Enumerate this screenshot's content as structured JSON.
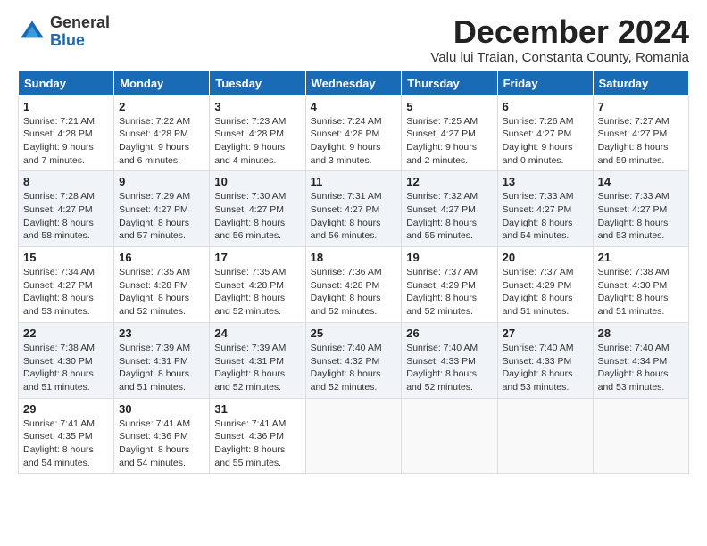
{
  "header": {
    "logo_general": "General",
    "logo_blue": "Blue",
    "month_title": "December 2024",
    "location": "Valu lui Traian, Constanta County, Romania"
  },
  "weekdays": [
    "Sunday",
    "Monday",
    "Tuesday",
    "Wednesday",
    "Thursday",
    "Friday",
    "Saturday"
  ],
  "weeks": [
    [
      {
        "day": "1",
        "info": "Sunrise: 7:21 AM\nSunset: 4:28 PM\nDaylight: 9 hours\nand 7 minutes."
      },
      {
        "day": "2",
        "info": "Sunrise: 7:22 AM\nSunset: 4:28 PM\nDaylight: 9 hours\nand 6 minutes."
      },
      {
        "day": "3",
        "info": "Sunrise: 7:23 AM\nSunset: 4:28 PM\nDaylight: 9 hours\nand 4 minutes."
      },
      {
        "day": "4",
        "info": "Sunrise: 7:24 AM\nSunset: 4:28 PM\nDaylight: 9 hours\nand 3 minutes."
      },
      {
        "day": "5",
        "info": "Sunrise: 7:25 AM\nSunset: 4:27 PM\nDaylight: 9 hours\nand 2 minutes."
      },
      {
        "day": "6",
        "info": "Sunrise: 7:26 AM\nSunset: 4:27 PM\nDaylight: 9 hours\nand 0 minutes."
      },
      {
        "day": "7",
        "info": "Sunrise: 7:27 AM\nSunset: 4:27 PM\nDaylight: 8 hours\nand 59 minutes."
      }
    ],
    [
      {
        "day": "8",
        "info": "Sunrise: 7:28 AM\nSunset: 4:27 PM\nDaylight: 8 hours\nand 58 minutes."
      },
      {
        "day": "9",
        "info": "Sunrise: 7:29 AM\nSunset: 4:27 PM\nDaylight: 8 hours\nand 57 minutes."
      },
      {
        "day": "10",
        "info": "Sunrise: 7:30 AM\nSunset: 4:27 PM\nDaylight: 8 hours\nand 56 minutes."
      },
      {
        "day": "11",
        "info": "Sunrise: 7:31 AM\nSunset: 4:27 PM\nDaylight: 8 hours\nand 56 minutes."
      },
      {
        "day": "12",
        "info": "Sunrise: 7:32 AM\nSunset: 4:27 PM\nDaylight: 8 hours\nand 55 minutes."
      },
      {
        "day": "13",
        "info": "Sunrise: 7:33 AM\nSunset: 4:27 PM\nDaylight: 8 hours\nand 54 minutes."
      },
      {
        "day": "14",
        "info": "Sunrise: 7:33 AM\nSunset: 4:27 PM\nDaylight: 8 hours\nand 53 minutes."
      }
    ],
    [
      {
        "day": "15",
        "info": "Sunrise: 7:34 AM\nSunset: 4:27 PM\nDaylight: 8 hours\nand 53 minutes."
      },
      {
        "day": "16",
        "info": "Sunrise: 7:35 AM\nSunset: 4:28 PM\nDaylight: 8 hours\nand 52 minutes."
      },
      {
        "day": "17",
        "info": "Sunrise: 7:35 AM\nSunset: 4:28 PM\nDaylight: 8 hours\nand 52 minutes."
      },
      {
        "day": "18",
        "info": "Sunrise: 7:36 AM\nSunset: 4:28 PM\nDaylight: 8 hours\nand 52 minutes."
      },
      {
        "day": "19",
        "info": "Sunrise: 7:37 AM\nSunset: 4:29 PM\nDaylight: 8 hours\nand 52 minutes."
      },
      {
        "day": "20",
        "info": "Sunrise: 7:37 AM\nSunset: 4:29 PM\nDaylight: 8 hours\nand 51 minutes."
      },
      {
        "day": "21",
        "info": "Sunrise: 7:38 AM\nSunset: 4:30 PM\nDaylight: 8 hours\nand 51 minutes."
      }
    ],
    [
      {
        "day": "22",
        "info": "Sunrise: 7:38 AM\nSunset: 4:30 PM\nDaylight: 8 hours\nand 51 minutes."
      },
      {
        "day": "23",
        "info": "Sunrise: 7:39 AM\nSunset: 4:31 PM\nDaylight: 8 hours\nand 51 minutes."
      },
      {
        "day": "24",
        "info": "Sunrise: 7:39 AM\nSunset: 4:31 PM\nDaylight: 8 hours\nand 52 minutes."
      },
      {
        "day": "25",
        "info": "Sunrise: 7:40 AM\nSunset: 4:32 PM\nDaylight: 8 hours\nand 52 minutes."
      },
      {
        "day": "26",
        "info": "Sunrise: 7:40 AM\nSunset: 4:33 PM\nDaylight: 8 hours\nand 52 minutes."
      },
      {
        "day": "27",
        "info": "Sunrise: 7:40 AM\nSunset: 4:33 PM\nDaylight: 8 hours\nand 53 minutes."
      },
      {
        "day": "28",
        "info": "Sunrise: 7:40 AM\nSunset: 4:34 PM\nDaylight: 8 hours\nand 53 minutes."
      }
    ],
    [
      {
        "day": "29",
        "info": "Sunrise: 7:41 AM\nSunset: 4:35 PM\nDaylight: 8 hours\nand 54 minutes."
      },
      {
        "day": "30",
        "info": "Sunrise: 7:41 AM\nSunset: 4:36 PM\nDaylight: 8 hours\nand 54 minutes."
      },
      {
        "day": "31",
        "info": "Sunrise: 7:41 AM\nSunset: 4:36 PM\nDaylight: 8 hours\nand 55 minutes."
      },
      {
        "day": "",
        "info": ""
      },
      {
        "day": "",
        "info": ""
      },
      {
        "day": "",
        "info": ""
      },
      {
        "day": "",
        "info": ""
      }
    ]
  ]
}
